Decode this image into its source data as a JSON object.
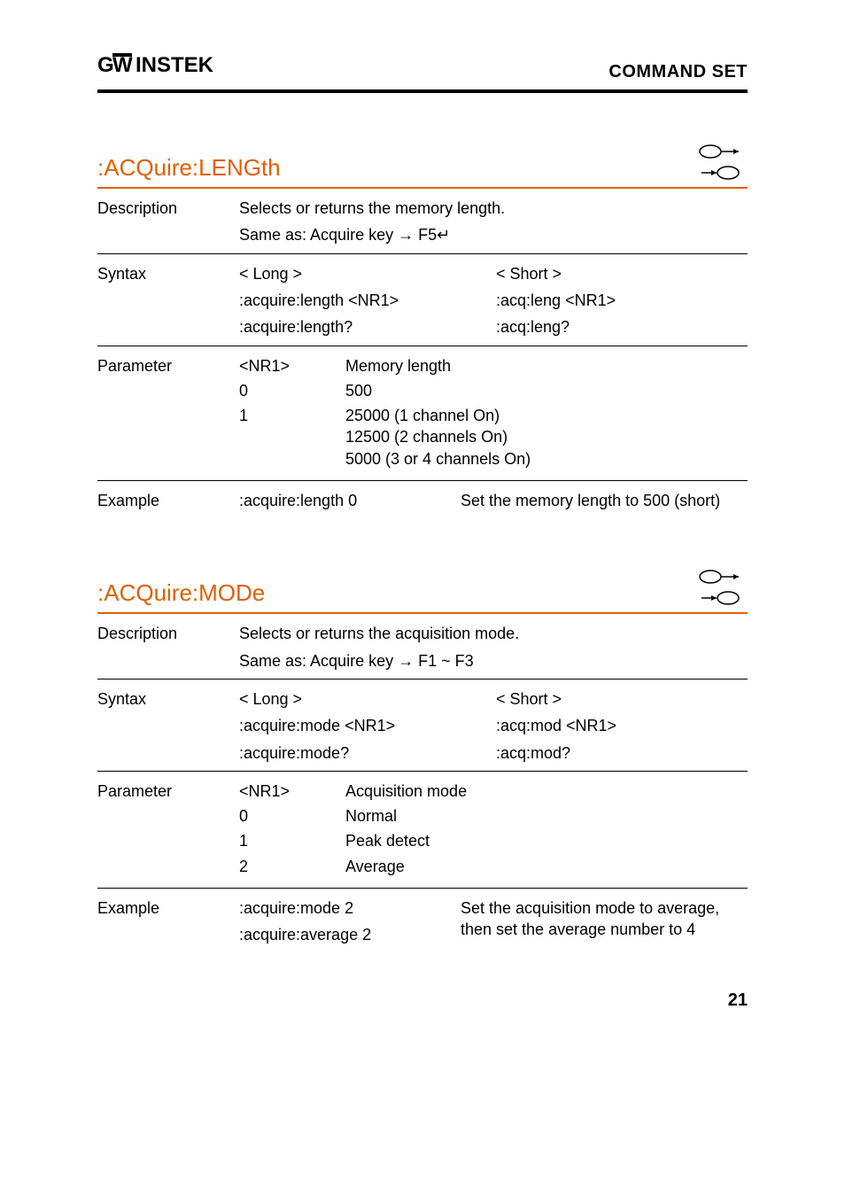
{
  "header": {
    "logo": "GWINSTEK",
    "section": "COMMAND SET"
  },
  "commands": [
    {
      "title": ":ACQuire:LENGth",
      "description": {
        "line1": "Selects or returns the memory length.",
        "line2": "Same as: Acquire key → F5↵"
      },
      "syntax": {
        "longHeader": "< Long >",
        "shortHeader": "< Short >",
        "long1": ":acquire:length <NR1>",
        "short1": ":acq:leng <NR1>",
        "long2": ":acquire:length?",
        "short2": ":acq:leng?"
      },
      "parameter": {
        "header": {
          "val": "<NR1>",
          "desc": "Memory length"
        },
        "rows": [
          {
            "val": "0",
            "desc": "500"
          },
          {
            "val": "1",
            "desc": "25000 (1 channel On)\n12500 (2 channels On)\n5000 (3 or 4 channels On)"
          }
        ]
      },
      "example": {
        "lines": [
          {
            "cmd": ":acquire:length 0"
          }
        ],
        "result": "Set the memory length to 500 (short)"
      }
    },
    {
      "title": ":ACQuire:MODe",
      "description": {
        "line1": "Selects or returns the acquisition mode.",
        "line2": "Same as: Acquire key → F1 ~ F3"
      },
      "syntax": {
        "longHeader": "< Long >",
        "shortHeader": "< Short >",
        "long1": ":acquire:mode <NR1>",
        "short1": ":acq:mod <NR1>",
        "long2": ":acquire:mode?",
        "short2": ":acq:mod?"
      },
      "parameter": {
        "header": {
          "val": "<NR1>",
          "desc": "Acquisition mode"
        },
        "rows": [
          {
            "val": "0",
            "desc": "Normal"
          },
          {
            "val": "1",
            "desc": "Peak detect"
          },
          {
            "val": "2",
            "desc": "Average"
          }
        ]
      },
      "example": {
        "lines": [
          {
            "cmd": ":acquire:mode 2"
          },
          {
            "cmd": ":acquire:average 2"
          }
        ],
        "result": "Set the acquisition mode to average, then set the average number to 4"
      }
    }
  ],
  "pagenum": "21",
  "labels": {
    "description": "Description",
    "syntax": "Syntax",
    "parameter": "Parameter",
    "example": "Example"
  }
}
